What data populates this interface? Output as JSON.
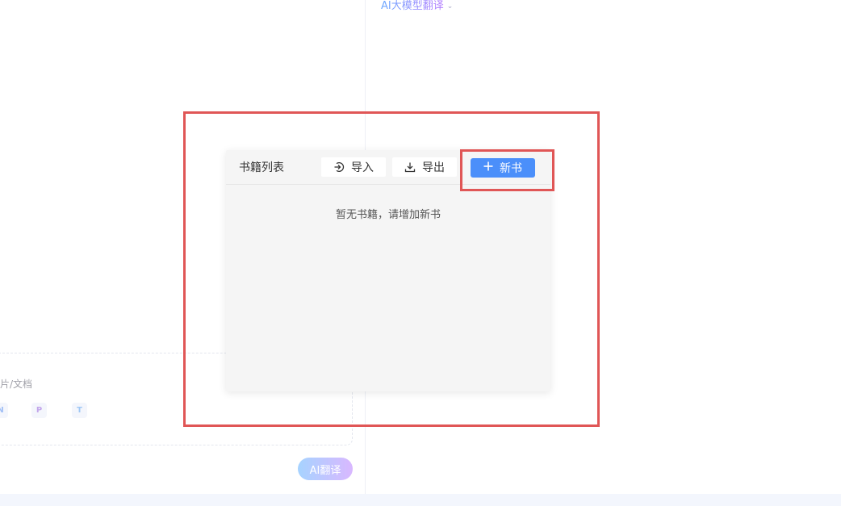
{
  "header": {
    "model_selector": {
      "label": "AI大模型翻译",
      "icon": "chevron-down-icon"
    }
  },
  "upload": {
    "hint": "片/文档",
    "file_types": [
      "N",
      "P",
      "T"
    ]
  },
  "actions": {
    "translate_label": "AI翻译"
  },
  "book_panel": {
    "title": "书籍列表",
    "import_label": "导入",
    "import_icon": "import-icon",
    "export_label": "导出",
    "export_icon": "download-icon",
    "new_book_label": "新书",
    "new_book_icon": "plus-icon",
    "empty_text": "暂无书籍，请增加新书"
  },
  "colors": {
    "primary": "#4b8ffa",
    "highlight": "#e05656",
    "panel_bg": "#f5f5f5"
  }
}
